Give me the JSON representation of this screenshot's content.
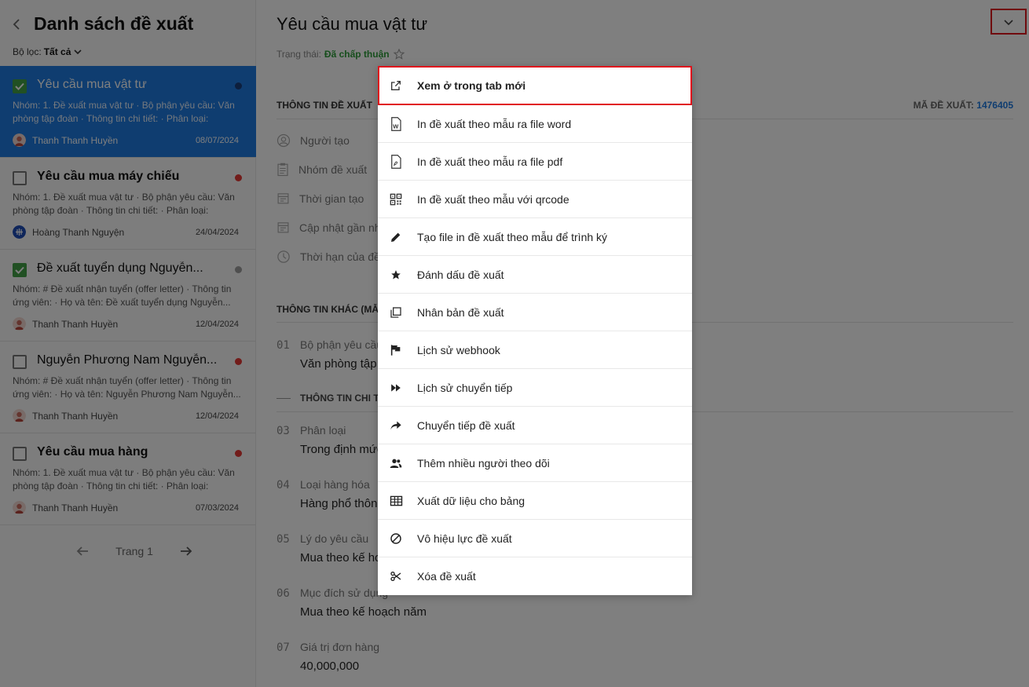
{
  "left": {
    "title": "Danh sách đề xuất",
    "filter_label": "Bộ lọc:",
    "filter_value": "Tất cả",
    "cards": [
      {
        "title": "Yêu cầu mua vật tư",
        "desc": "Nhóm: 1. Đề xuất mua vật tư · Bộ phận yêu cầu: Văn phòng tập đoàn · Thông tin chi tiết: · Phân loại: Trong...",
        "user": "Thanh Thanh Huyền",
        "date": "08/07/2024",
        "checked": true,
        "dot_color": "#1a3e7a"
      },
      {
        "title": "Yêu cầu mua máy chiếu",
        "desc": "Nhóm: 1. Đề xuất mua vật tư · Bộ phận yêu cầu: Văn phòng tập đoàn · Thông tin chi tiết: · Phân loại: Trong...",
        "user": "Hoàng Thanh Nguyện",
        "date": "24/04/2024",
        "checked": false,
        "dot_color": "#e53935"
      },
      {
        "title": "Đề xuất tuyển dụng Nguyễn...",
        "desc": "Nhóm: # Đề xuất nhận tuyển (offer letter) · Thông tin ứng viên: · Họ và tên: Đề xuất tuyển dụng Nguyễn...",
        "user": "Thanh Thanh Huyền",
        "date": "12/04/2024",
        "checked": true,
        "dot_color": "#9e9e9e"
      },
      {
        "title": "Nguyễn Phương Nam Nguyễn...",
        "desc": "Nhóm: # Đề xuất nhận tuyển (offer letter) · Thông tin ứng viên: · Họ và tên: Nguyễn Phương Nam Nguyễn...",
        "user": "Thanh Thanh Huyền",
        "date": "12/04/2024",
        "checked": false,
        "dot_color": "#e53935"
      },
      {
        "title": "Yêu cầu mua hàng",
        "desc": "Nhóm: 1. Đề xuất mua vật tư · Bộ phận yêu cầu: Văn phòng tập đoàn · Thông tin chi tiết: · Phân loại: Trong...",
        "user": "Thanh Thanh Huyền",
        "date": "07/03/2024",
        "checked": false,
        "dot_color": "#e53935"
      }
    ],
    "pager": {
      "label": "Trang 1"
    }
  },
  "right": {
    "title": "Yêu cầu mua vật tư",
    "status_label": "Trạng thái:",
    "status_value": "Đã chấp thuận",
    "section1": "THÔNG TIN ĐỀ XUẤT",
    "code_label": "MÃ ĐỀ XUẤT:",
    "code_value": "1476405",
    "info": [
      {
        "label": "Người tạo",
        "icon": "user-icon"
      },
      {
        "label": "Nhóm đề xuất",
        "icon": "clipboard-icon"
      },
      {
        "label": "Thời gian tạo",
        "icon": "calendar-icon"
      },
      {
        "label": "Cập nhật gần nh",
        "icon": "calendar-icon"
      },
      {
        "label": "Thời hạn của đề",
        "icon": "clock-icon"
      }
    ],
    "section2": "THÔNG TIN KHÁC (MẪU",
    "sub_head": "THÔNG TIN CHI TI",
    "fields": [
      {
        "num": "01",
        "label": "Bộ phận yêu cầu",
        "value": "Văn phòng tập"
      },
      {
        "num": "03",
        "label": "Phân loại",
        "value": "Trong định mức"
      },
      {
        "num": "04",
        "label": "Loại hàng hóa",
        "value": "Hàng phổ thôn"
      },
      {
        "num": "05",
        "label": "Lý do yêu cầu",
        "value": "Mua theo kế ho"
      },
      {
        "num": "06",
        "label": "Mục đích sử dụng",
        "value": "Mua theo kế hoạch năm"
      },
      {
        "num": "07",
        "label": "Giá trị đơn hàng",
        "value": "40,000,000"
      }
    ]
  },
  "menu": {
    "items": [
      {
        "label": "Xem ở trong tab mới",
        "icon": "external-link-icon"
      },
      {
        "label": "In đề xuất theo mẫu ra file word",
        "icon": "word-file-icon"
      },
      {
        "label": "In đề xuất theo mẫu ra file pdf",
        "icon": "pdf-file-icon"
      },
      {
        "label": "In đề xuất theo mẫu với qrcode",
        "icon": "qrcode-icon"
      },
      {
        "label": "Tạo file in đề xuất theo mẫu để trình ký",
        "icon": "pencil-icon"
      },
      {
        "label": "Đánh dấu đề xuất",
        "icon": "star-icon"
      },
      {
        "label": "Nhân bản đề xuất",
        "icon": "copy-icon"
      },
      {
        "label": "Lịch sử webhook",
        "icon": "flag-icon"
      },
      {
        "label": "Lịch sử chuyển tiếp",
        "icon": "fast-forward-icon"
      },
      {
        "label": "Chuyển tiếp đề xuất",
        "icon": "forward-arrow-icon"
      },
      {
        "label": "Thêm nhiều người theo dõi",
        "icon": "users-icon"
      },
      {
        "label": "Xuất dữ liệu cho bảng",
        "icon": "table-icon"
      },
      {
        "label": "Vô hiệu lực đề xuất",
        "icon": "ban-icon"
      },
      {
        "label": "Xóa đề xuất",
        "icon": "scissors-icon"
      }
    ]
  },
  "colors": {
    "accent": "#1f7ae0",
    "approved": "#2e9d3a",
    "highlight": "#e0141c"
  }
}
